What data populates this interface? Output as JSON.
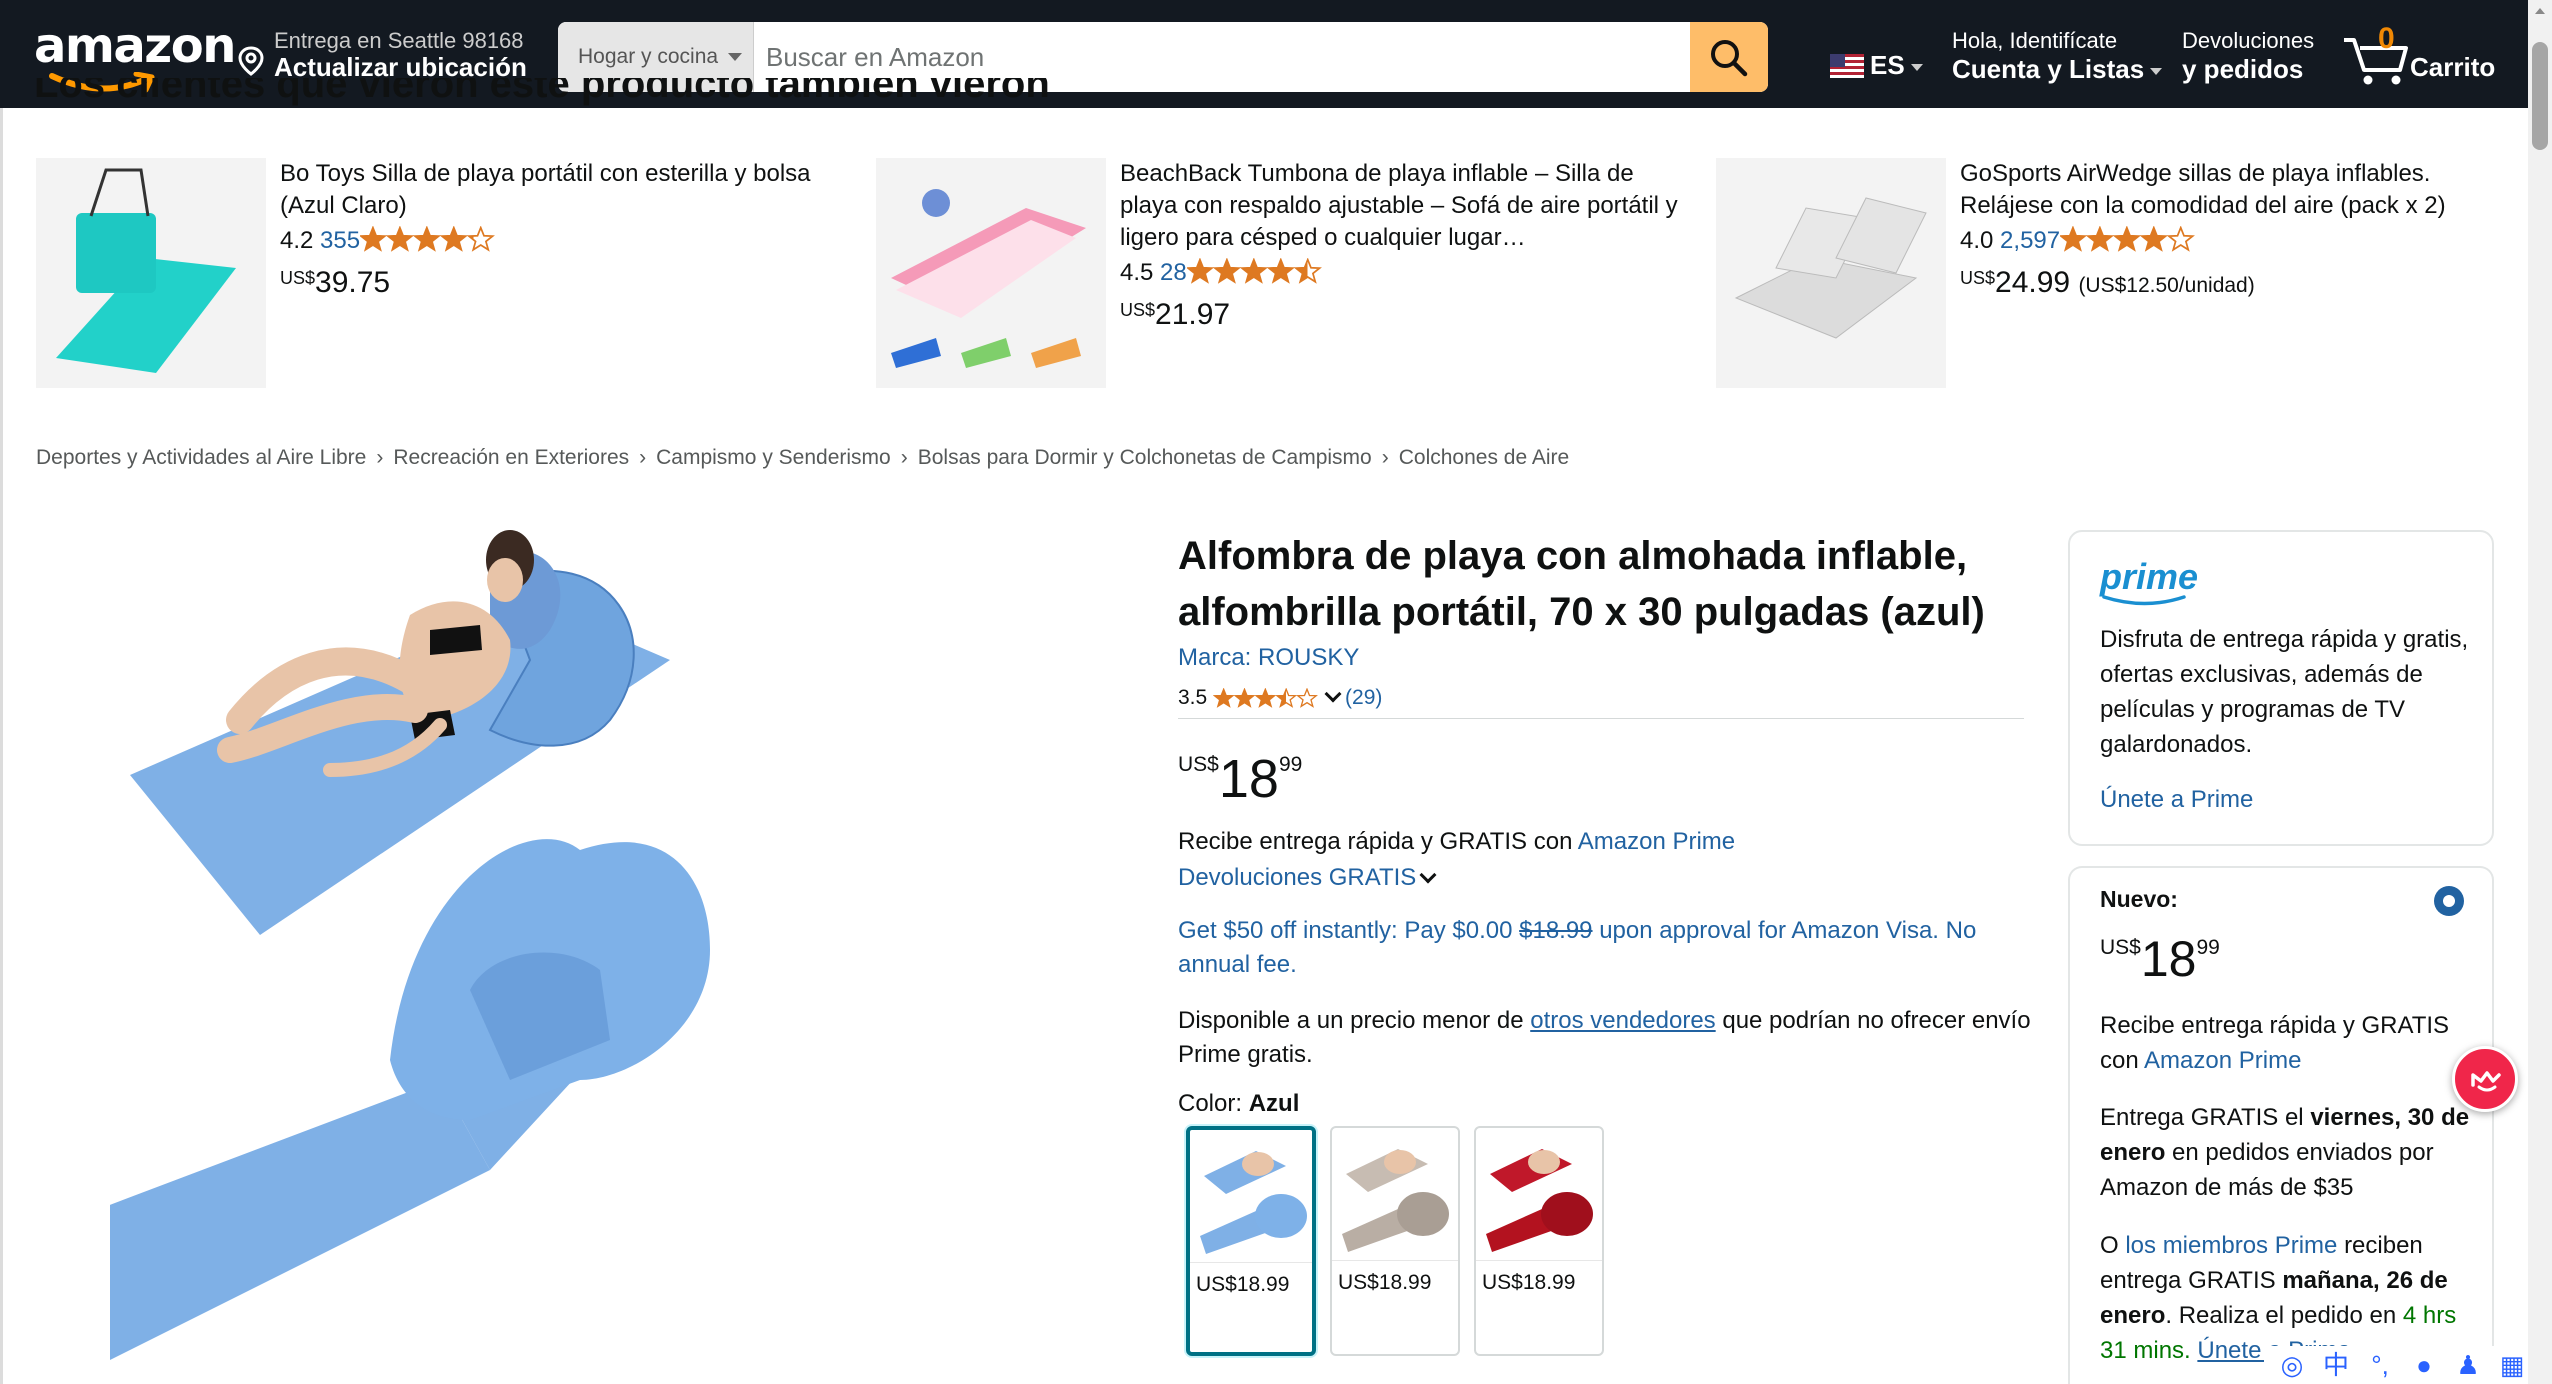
{
  "nav": {
    "logo": "amazon",
    "deliver_line1": "Entrega en Seattle 98168",
    "deliver_line2": "Actualizar ubicación",
    "search_category": "Hogar y cocina",
    "search_placeholder": "Buscar en Amazon",
    "lang": "ES",
    "account_line1": "Hola, Identifícate",
    "account_line2": "Cuenta y Listas",
    "returns_line1": "Devoluciones",
    "returns_line2": "y pedidos",
    "cart_count": "0",
    "cart_label": "Carrito"
  },
  "carousel": {
    "heading": "Los clientes que vieron este producto también vieron",
    "items": [
      {
        "title": "Bo Toys Silla de playa portátil con esterilla y bolsa (Azul Claro)",
        "rating": "4.2",
        "stars": 4.2,
        "count": "355",
        "price_cur": "US$",
        "price": "39.75",
        "unit": ""
      },
      {
        "title": "BeachBack Tumbona de playa inflable – Silla de playa con respaldo ajustable – Sofá de aire portátil y ligero para césped o cualquier lugar…",
        "rating": "4.5",
        "stars": 4.5,
        "count": "28",
        "price_cur": "US$",
        "price": "21.97",
        "unit": ""
      },
      {
        "title": "GoSports AirWedge sillas de playa inflables. Relájese con la comodidad del aire (pack x 2)",
        "rating": "4.0",
        "stars": 4.0,
        "count": "2,597",
        "price_cur": "US$",
        "price": "24.99",
        "unit": "(US$12.50/unidad)"
      }
    ]
  },
  "breadcrumb": [
    "Deportes y Actividades al Aire Libre",
    "Recreación en Exteriores",
    "Campismo y Senderismo",
    "Bolsas para Dormir y Colchonetas de Campismo",
    "Colchones de Aire"
  ],
  "product": {
    "title": "Alfombra de playa con almohada inflable, alfombrilla portátil, 70 x 30 pulgadas (azul)",
    "brand": "Marca: ROUSKY",
    "rating": "3.5",
    "stars": 3.5,
    "rating_count": "(29)",
    "price_cur": "US$",
    "price_whole": "18",
    "price_frac": "99",
    "delivery_text": "Recibe entrega rápida y GRATIS con",
    "delivery_link": "Amazon Prime",
    "returns": "Devoluciones GRATIS",
    "visa_pre": "Get $50 off instantly: Pay $0.00",
    "visa_strike": "$18.99",
    "visa_post": "upon approval for Amazon Visa. No annual fee.",
    "avail_pre": "Disponible a un precio menor de",
    "avail_link": "otros vendedores",
    "avail_post": "que podrían no ofrecer envío Prime gratis.",
    "color_label": "Color:",
    "color_value": "Azul",
    "swatches": [
      {
        "price": "US$18.99",
        "color": "#7fb3e8"
      },
      {
        "price": "US$18.99",
        "color": "#b9aea4"
      },
      {
        "price": "US$18.99",
        "color": "#b3121f"
      }
    ]
  },
  "prime_box": {
    "logo": "prime",
    "text": "Disfruta de entrega rápida y gratis, ofertas exclusivas, además de películas y programas de TV galardonados.",
    "join": "Únete a Prime"
  },
  "buy_box": {
    "label": "Nuevo:",
    "price_cur": "US$",
    "price_whole": "18",
    "price_frac": "99",
    "p1_text": "Recibe entrega rápida y GRATIS con",
    "p1_link": "Amazon Prime",
    "p2_pre": "Entrega GRATIS el",
    "p2_bold": "viernes, 30 de enero",
    "p2_post": "en pedidos enviados por Amazon de más de $35",
    "p3_pre": "O",
    "p3_link": "los miembros Prime",
    "p3_mid": "reciben entrega GRATIS",
    "p3_bold": "mañana, 26 de enero",
    "p3_post": ". Realiza el pedido en",
    "p3_time": "4 hrs 31 mins.",
    "p3_join": "Únete a Prime"
  },
  "colors": {
    "nav_bg": "#131921",
    "search_btn": "#febd69",
    "link": "#2162a1",
    "star": "#de7921",
    "cart_count": "#f08804"
  }
}
